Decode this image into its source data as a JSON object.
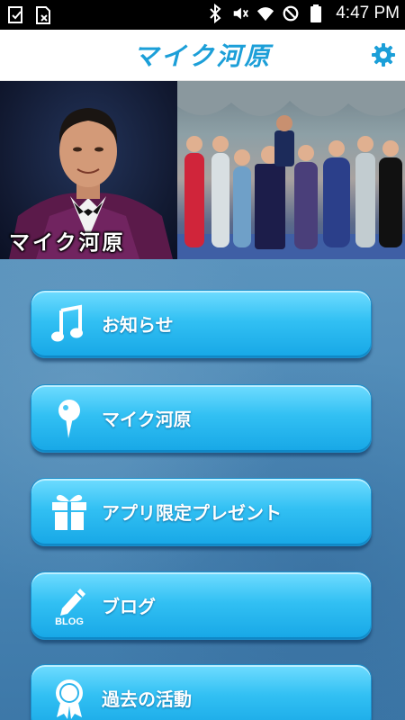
{
  "status_bar": {
    "time": "4:47 PM",
    "left_icons": [
      "download-complete-icon",
      "sim-error-icon"
    ],
    "right_icons": [
      "bluetooth-icon",
      "mute-icon",
      "wifi-icon",
      "do-not-disturb-icon",
      "battery-icon"
    ]
  },
  "header": {
    "title": "マイク河原",
    "settings_icon": "gear-icon"
  },
  "banner": {
    "caption": "マイク河原"
  },
  "menu": {
    "items": [
      {
        "label": "お知らせ",
        "icon": "music-note-icon"
      },
      {
        "label": "マイク河原",
        "icon": "map-pin-icon"
      },
      {
        "label": "アプリ限定プレゼント",
        "icon": "gift-icon"
      },
      {
        "label": "ブログ",
        "icon": "blog-pencil-icon",
        "icon_text": "BLOG"
      },
      {
        "label": "過去の活動",
        "icon": "award-ribbon-icon"
      }
    ]
  },
  "colors": {
    "accent": "#1c9fd8",
    "button_top": "#6fdcff",
    "button_bottom": "#17a7e6",
    "background": "#4a86b4"
  }
}
